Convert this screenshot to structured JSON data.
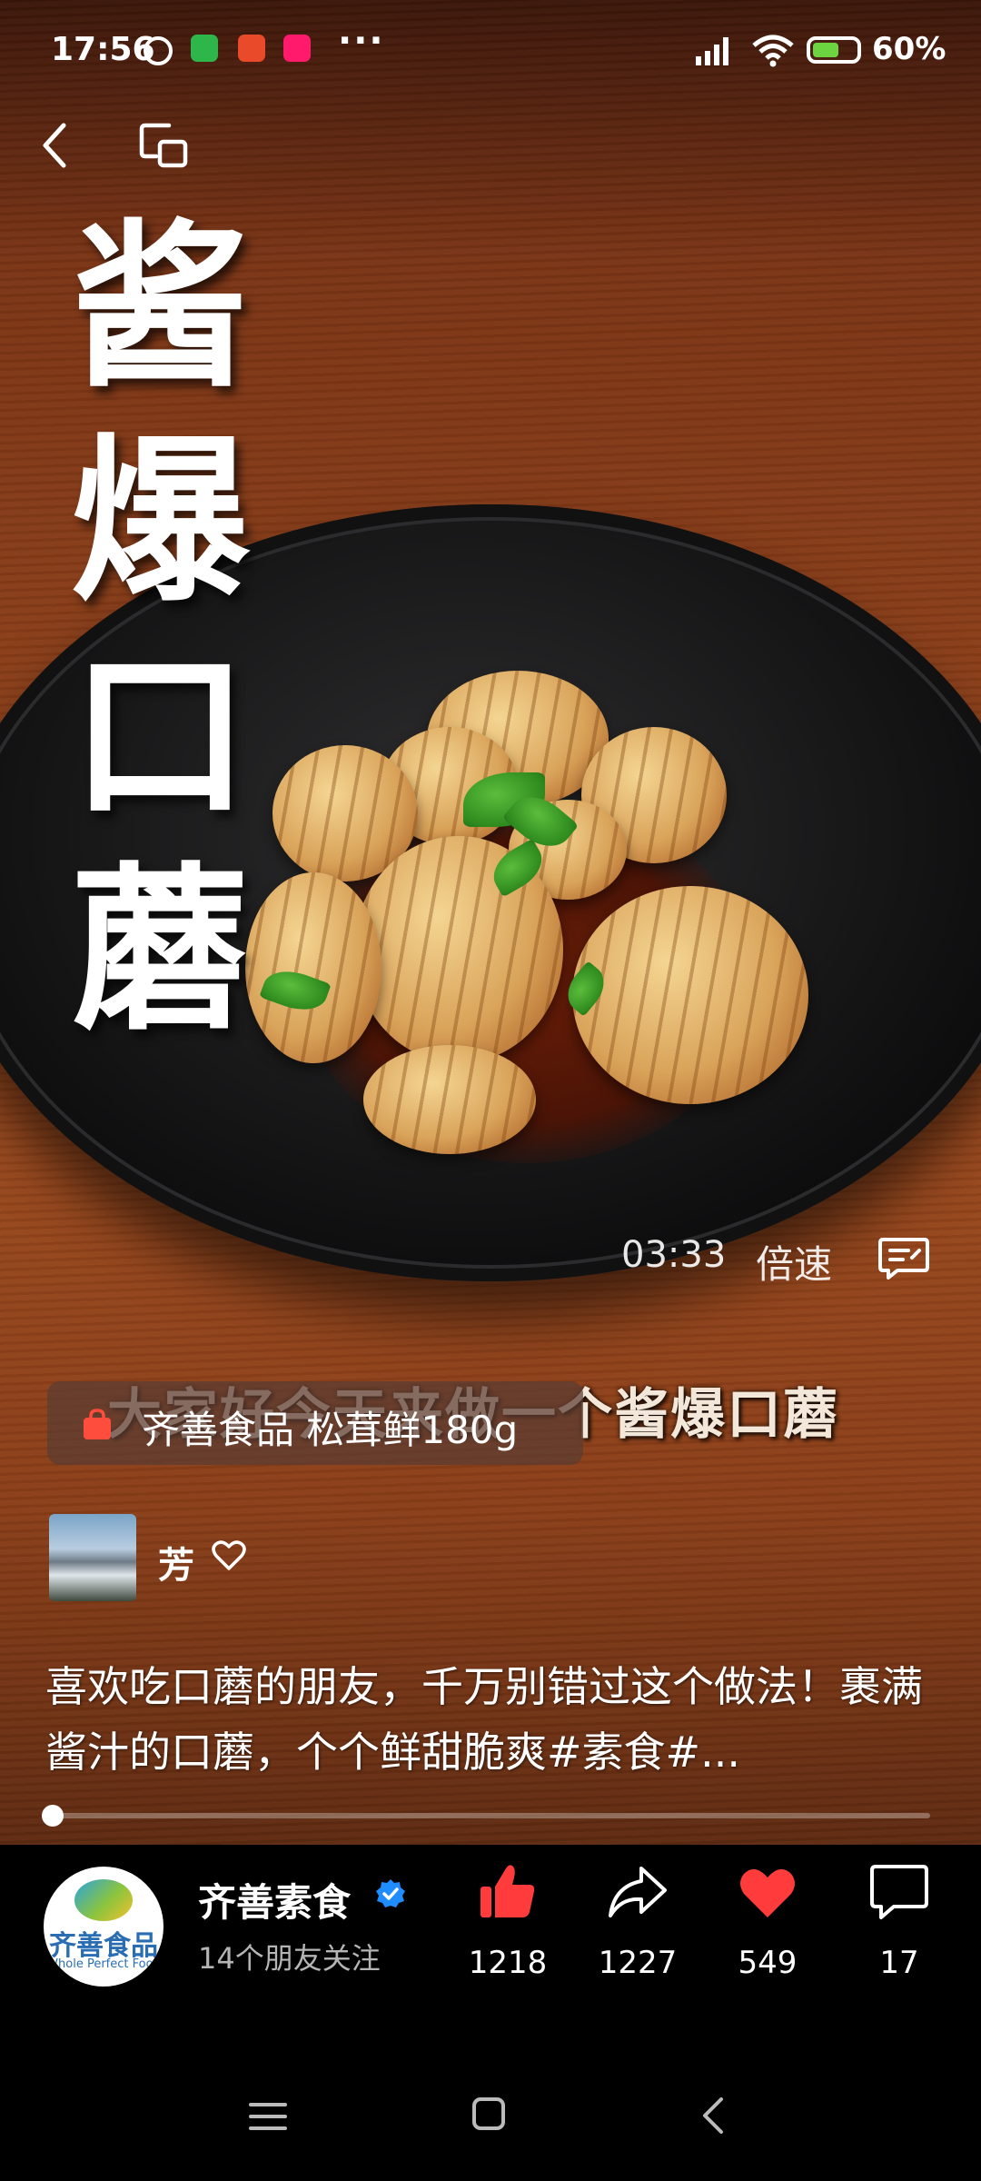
{
  "status_bar": {
    "time": "17:56",
    "more": "···",
    "battery_percent_label": "60%",
    "battery_level": 0.6,
    "icons": [
      "alarm-icon",
      "app-icon-1",
      "app-icon-2",
      "app-icon-3",
      "signal-icon",
      "wifi-icon",
      "battery-icon"
    ]
  },
  "nav": {
    "icons": [
      "back-icon",
      "pip-icon"
    ]
  },
  "video": {
    "title": "酱爆口蘑",
    "time": "03:33",
    "speed_label": "倍速",
    "caption": "大家好今天来做一个酱爆口蘑",
    "progress": 0.0
  },
  "product": {
    "label": "齐善食品 松茸鲜180g",
    "icon": "shopping-bag-icon"
  },
  "comment_user": {
    "name": "芳"
  },
  "description": "喜欢吃口蘑的朋友，千万别错过这个做法！裹满酱汁的口蘑，个个鲜甜脆爽#素食#...",
  "author": {
    "name": "齐善素食",
    "followers": "14个朋友关注",
    "logo_text": "齐善食品",
    "logo_subtext": "Whole Perfect Food"
  },
  "actions": {
    "like": "1218",
    "share": "1227",
    "favorite": "549",
    "comment": "17"
  },
  "colors": {
    "like": "#ff3b3b",
    "favorite": "#ff3b3b",
    "verified": "#1f8cff",
    "bag": "#ff4d3d"
  }
}
